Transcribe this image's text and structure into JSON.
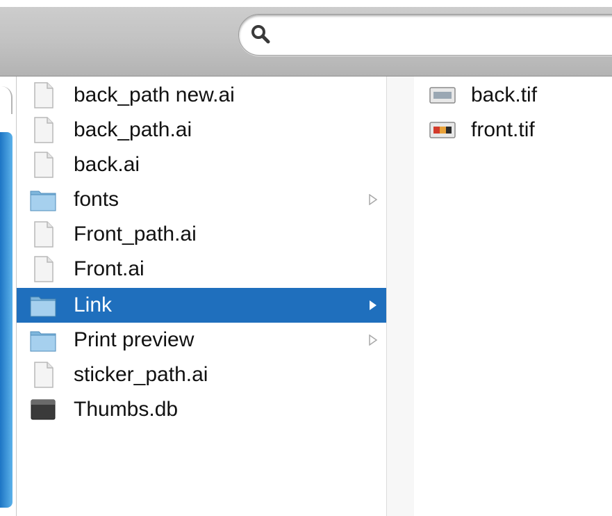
{
  "search": {
    "placeholder": "",
    "value": ""
  },
  "column1": {
    "items": [
      {
        "label": "back_path new.ai",
        "icon": "document-icon",
        "has_children": false,
        "selected": false
      },
      {
        "label": "back_path.ai",
        "icon": "document-icon",
        "has_children": false,
        "selected": false
      },
      {
        "label": "back.ai",
        "icon": "document-icon",
        "has_children": false,
        "selected": false
      },
      {
        "label": "fonts",
        "icon": "folder-icon",
        "has_children": true,
        "selected": false
      },
      {
        "label": "Front_path.ai",
        "icon": "document-icon",
        "has_children": false,
        "selected": false
      },
      {
        "label": "Front.ai",
        "icon": "document-icon",
        "has_children": false,
        "selected": false
      },
      {
        "label": "Link",
        "icon": "folder-icon",
        "has_children": true,
        "selected": true
      },
      {
        "label": "Print preview",
        "icon": "folder-icon",
        "has_children": true,
        "selected": false
      },
      {
        "label": "sticker_path.ai",
        "icon": "document-icon",
        "has_children": false,
        "selected": false
      },
      {
        "label": "Thumbs.db",
        "icon": "database-file-icon",
        "has_children": false,
        "selected": false
      }
    ]
  },
  "column2": {
    "items": [
      {
        "label": "back.tif",
        "icon": "image-thumbnail-icon"
      },
      {
        "label": "front.tif",
        "icon": "image-thumbnail-icon"
      }
    ]
  },
  "colors": {
    "selection": "#1f6fbd",
    "toolbar": "#c2c2c2",
    "text": "#111111"
  }
}
